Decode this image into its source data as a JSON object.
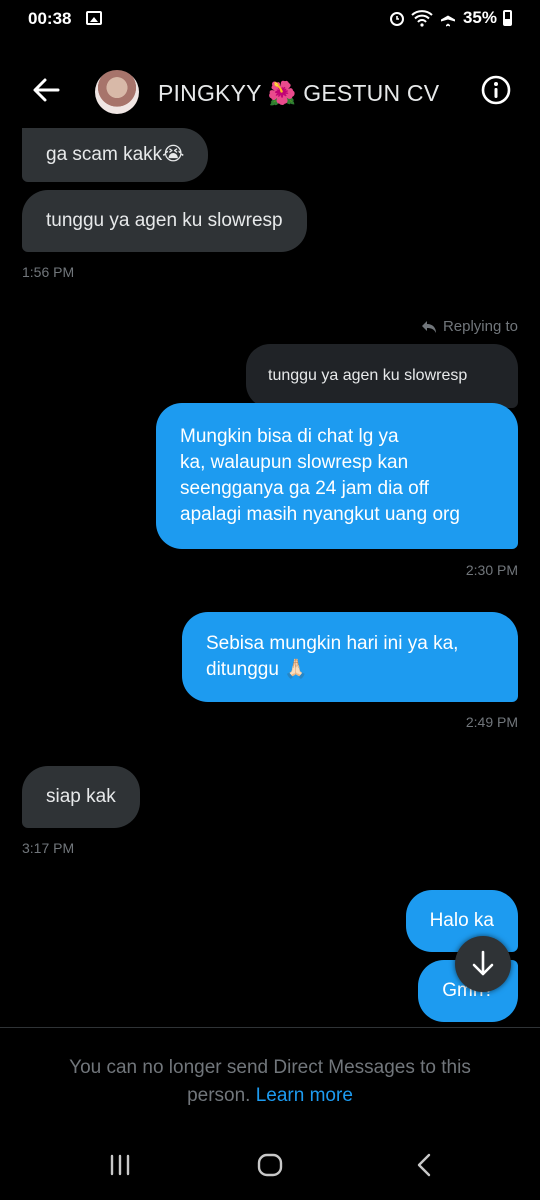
{
  "status_bar": {
    "time": "00:38",
    "battery_pct": "35%"
  },
  "header": {
    "contact_name": "PINGKYY 🌺 GESTUN CV"
  },
  "messages": {
    "m1": "ga scam kakk😭",
    "m2": "tunggu ya agen ku slowresp",
    "t1": "1:56 PM",
    "reply_label": "Replying to",
    "quoted": "tunggu ya agen ku slowresp",
    "m3_l1": "Mungkin bisa di chat lg ya",
    "m3_l2": "ka, walaupun slowresp kan",
    "m3_l3": "seengganya ga 24 jam dia off",
    "m3_l4": "apalagi masih nyangkut uang org",
    "t2": "2:30 PM",
    "m4_l1": "Sebisa mungkin hari ini  ya ka,",
    "m4_l2": "ditunggu 🙏🏻",
    "t3": "2:49 PM",
    "m5": "siap kak",
    "t4": "3:17 PM",
    "m6": "Halo ka",
    "m7": "Gmn?"
  },
  "footer": {
    "notice": "You can no longer send Direct Messages to this person.",
    "link": "Learn more"
  },
  "icons": {
    "status": [
      "image-icon",
      "alarm-icon",
      "wifi-icon",
      "airplane-icon",
      "battery-icon"
    ],
    "header": [
      "back-arrow-icon",
      "info-icon"
    ],
    "chat": [
      "reply-arrow-icon",
      "arrow-down-icon"
    ],
    "nav": [
      "recents-icon",
      "home-icon",
      "back-icon"
    ]
  },
  "colors": {
    "accent": "#1d9bf0",
    "incoming_bubble": "#2f3336",
    "background": "#000000",
    "muted": "#71767b"
  }
}
